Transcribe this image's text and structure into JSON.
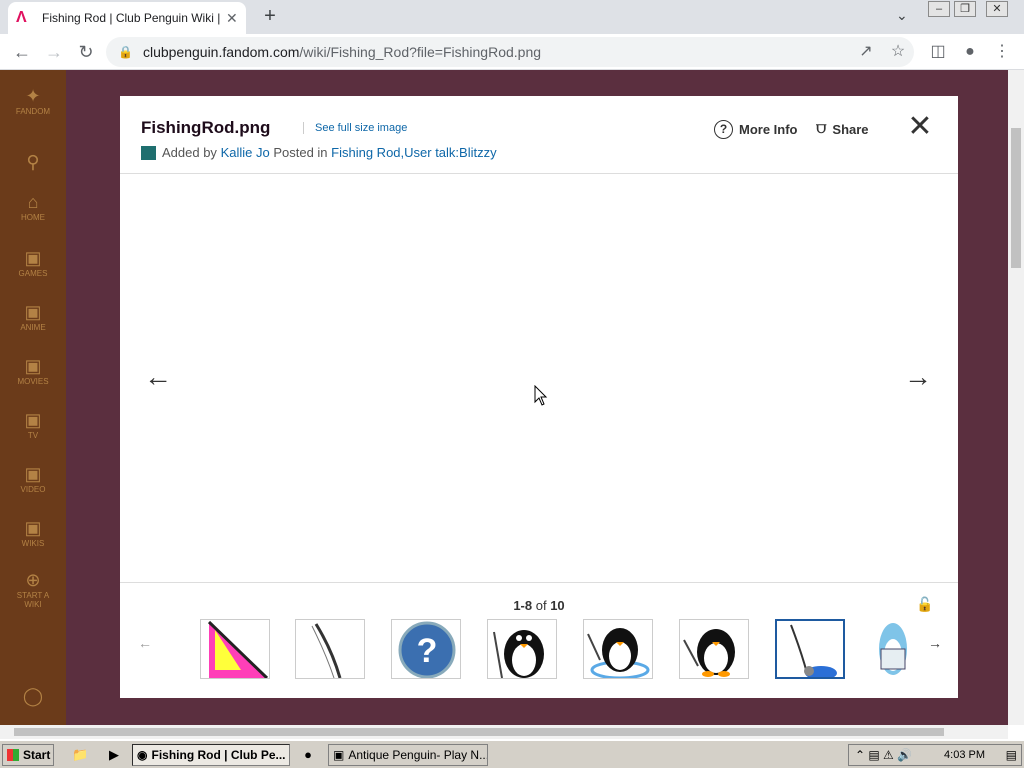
{
  "browser": {
    "tab_title": "Fishing Rod | Club Penguin Wiki | Fandom",
    "url_host": "clubpenguin.fandom.com",
    "url_path": "/wiki/Fishing_Rod?file=FishingRod.png"
  },
  "sidebar": {
    "items": [
      {
        "label": "FANDOM",
        "icon": "fandom-icon"
      },
      {
        "label": "",
        "icon": "search-icon"
      },
      {
        "label": "HOME",
        "icon": "home-icon"
      },
      {
        "label": "GAMES",
        "icon": "games-icon"
      },
      {
        "label": "ANIME",
        "icon": "anime-icon"
      },
      {
        "label": "MOVIES",
        "icon": "movies-icon"
      },
      {
        "label": "TV",
        "icon": "tv-icon"
      },
      {
        "label": "VIDEO",
        "icon": "video-icon"
      },
      {
        "label": "WIKIS",
        "icon": "wikis-icon"
      },
      {
        "label": "START A WIKI",
        "icon": "plus-icon"
      }
    ]
  },
  "modal": {
    "file_title": "FishingRod.png",
    "full_size_link": "See full size image",
    "added_prefix": "Added by",
    "author": "Kallie Jo",
    "posted_in": "Posted in",
    "posted_links": "Fishing Rod,User talk:Blitzzy",
    "more_info": "More Info",
    "share": "Share",
    "counter_range": "1-8",
    "counter_of": "of",
    "counter_total": "10"
  },
  "taskbar": {
    "start": "Start",
    "active_window": "Fishing Rod | Club Pe...",
    "other_window": "Antique Penguin- Play N...",
    "clock": "4:03 PM"
  },
  "colors": {
    "link": "#0e67a8",
    "active_thumb": "#1e5aa0"
  }
}
